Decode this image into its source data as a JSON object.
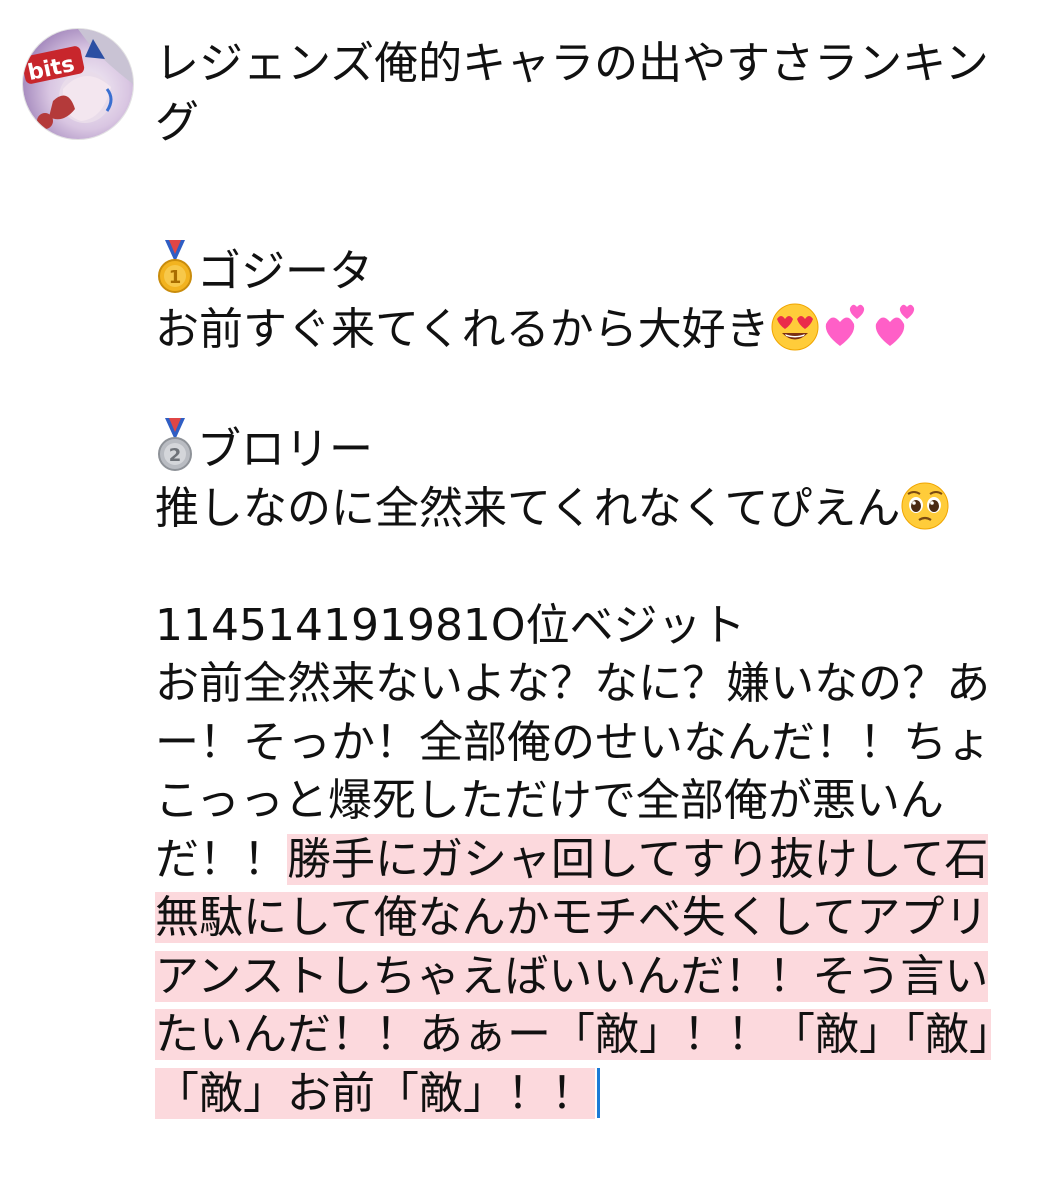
{
  "avatar": {
    "logo_text": "bits",
    "icon": "profile-avatar"
  },
  "post": {
    "title": "レジェンズ俺的キャラの出やすさランキング",
    "rank1": {
      "medal_icon": "gold-medal-icon",
      "name": "ゴジータ",
      "comment": "お前すぐ来てくれるから大好き",
      "emojis": [
        "heart-eyes-emoji-icon",
        "two-hearts-emoji-icon",
        "two-hearts-emoji-icon"
      ]
    },
    "rank2": {
      "medal_icon": "silver-medal-icon",
      "name": "ブロリー",
      "comment": "推しなのに全然来てくれなくてぴえん",
      "emojis": [
        "pleading-face-emoji-icon"
      ]
    },
    "rank_last": {
      "name": "114514191981O位ベジット",
      "comment_plain": "お前全然来ないよな？なに？嫌いなの？あー！そっか！全部俺のせいなんだ！！ちょこっっと爆死しただけで全部俺が悪いんだ！！",
      "comment_selected_1": "勝手にガシャ回してすり抜けして石無駄にして俺なんかモチベ失くしてアプリアンストしちゃえばいいんだ！！そう言いたいんだ！！あぁー",
      "comment_selected_2": "「敵」！！「敵」「敵」「敵」お前",
      "comment_selected_3": "「敵」！！"
    }
  },
  "colors": {
    "selection": "#fcd9dd",
    "caret": "#1b7bd6",
    "text": "#111111"
  }
}
